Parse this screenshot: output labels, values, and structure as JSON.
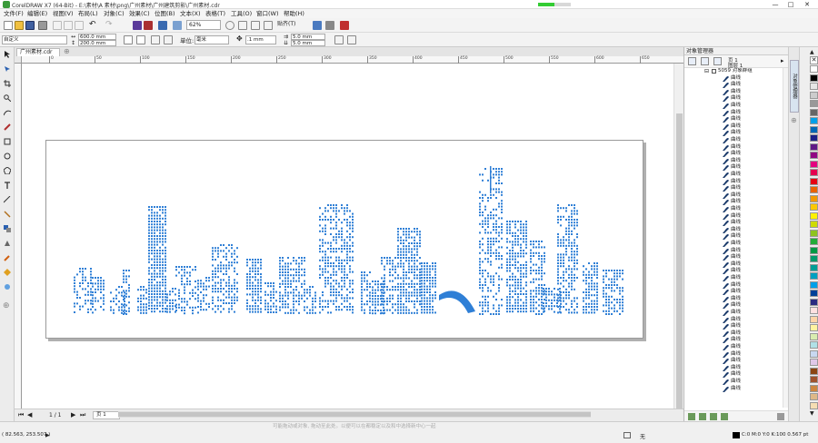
{
  "window": {
    "title": "CorelDRAW X7 (64-Bit) - E:\\素材\\A 素材\\png\\广州素材\\广州建筑剪影\\广州素材.cdr",
    "minimize": "—",
    "maximize": "□",
    "close": "✕"
  },
  "menu": [
    "文件(F)",
    "编辑(E)",
    "视图(V)",
    "布局(L)",
    "对象(C)",
    "效果(C)",
    "位图(B)",
    "文本(X)",
    "表格(T)",
    "工具(O)",
    "窗口(W)",
    "帮助(H)"
  ],
  "toolbar": {
    "zoom": "62%",
    "snap": "贴齐(T)"
  },
  "propbar": {
    "preset": "自定义",
    "width": "600.0 mm",
    "height": "200.0 mm",
    "units_label": "单位:",
    "units": "毫米",
    "nudge": ".1 mm",
    "dup_x": "5.0 mm",
    "dup_y": "5.0 mm"
  },
  "document_tab": "广州素材.cdr",
  "ruler_ticks": [
    "0",
    "50",
    "100",
    "150",
    "200",
    "250",
    "300",
    "350",
    "400",
    "450",
    "500",
    "550",
    "600",
    "650"
  ],
  "page_nav": {
    "current": "1 / 1",
    "page_tab": "页 1"
  },
  "object_manager": {
    "title": "对象管理器",
    "page": "页 1",
    "layer": "图层 1",
    "group": "5059 对象群组",
    "items": [
      "曲线",
      "曲线",
      "曲线",
      "曲线",
      "曲线",
      "曲线",
      "曲线",
      "曲线",
      "曲线",
      "曲线",
      "曲线",
      "曲线",
      "曲线",
      "曲线",
      "曲线",
      "曲线",
      "曲线",
      "曲线",
      "曲线",
      "曲线",
      "曲线",
      "曲线",
      "曲线",
      "曲线",
      "曲线",
      "曲线",
      "曲线",
      "曲线",
      "曲线",
      "曲线",
      "曲线",
      "曲线",
      "曲线",
      "曲线",
      "曲线",
      "曲线",
      "曲线",
      "曲线",
      "曲线",
      "曲线",
      "曲线",
      "曲线",
      "曲线",
      "曲线",
      "曲线",
      "曲线"
    ]
  },
  "side_tab": "对象管理器",
  "palette_colors": [
    "#ffffff",
    "#000000",
    "#e6e6e6",
    "#cccccc",
    "#999999",
    "#666666",
    "#00a0e9",
    "#0068b7",
    "#1d2088",
    "#601986",
    "#920783",
    "#e4007f",
    "#e5004f",
    "#e60012",
    "#eb6100",
    "#f39800",
    "#fcc800",
    "#fff100",
    "#cfdb00",
    "#8fc31f",
    "#22ac38",
    "#009944",
    "#009b6b",
    "#009e96",
    "#00a0c1",
    "#00a0e9",
    "#004098",
    "#2a2a80",
    "#ffe1e1",
    "#ffd4a8",
    "#fff3a0",
    "#d8ecb0",
    "#b0e0e6",
    "#c8d8f0",
    "#e0c8e8",
    "#8b4513",
    "#a0522d",
    "#cd853f",
    "#deb887",
    "#f5deb3"
  ],
  "status": {
    "hint": "可能拖动或对象, 拖动至此处。以便可以在都稳定以及和中选择新中心一起",
    "coords": "( 82.563, 253.507 )",
    "fill": "无",
    "outline": "C:0 M:0 Y:0 K:100  0.567 pt"
  },
  "colors": {
    "skyline": "#2f7fd6",
    "accent": "#3a9a3a"
  }
}
